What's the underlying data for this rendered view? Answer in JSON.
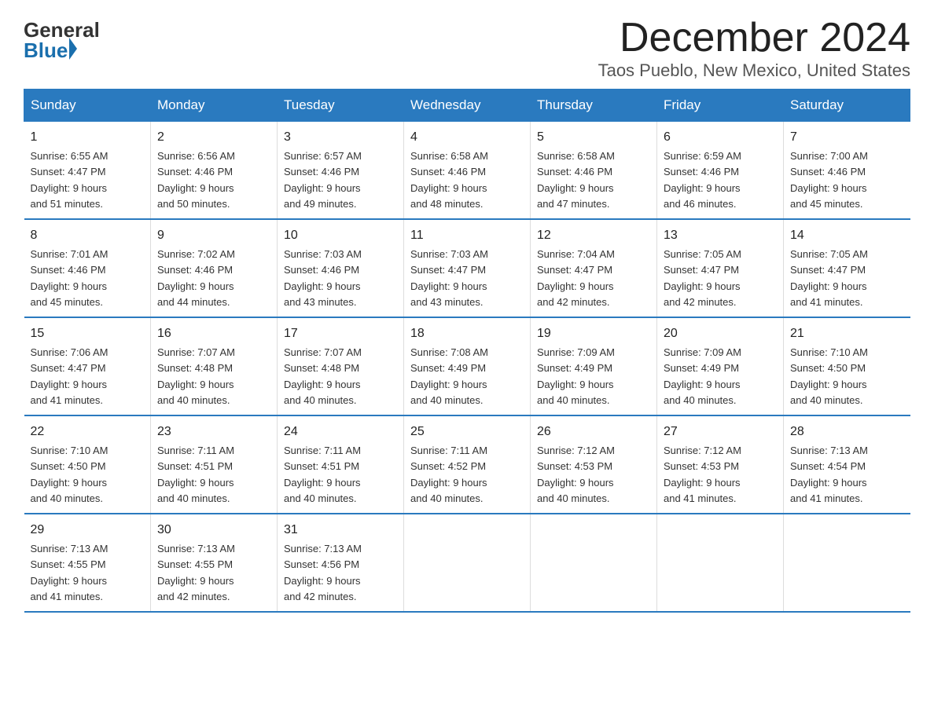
{
  "logo": {
    "general": "General",
    "blue": "Blue"
  },
  "title": {
    "month_year": "December 2024",
    "location": "Taos Pueblo, New Mexico, United States"
  },
  "header_days": [
    "Sunday",
    "Monday",
    "Tuesday",
    "Wednesday",
    "Thursday",
    "Friday",
    "Saturday"
  ],
  "weeks": [
    [
      {
        "day": "1",
        "sunrise": "6:55 AM",
        "sunset": "4:47 PM",
        "daylight": "9 hours and 51 minutes."
      },
      {
        "day": "2",
        "sunrise": "6:56 AM",
        "sunset": "4:46 PM",
        "daylight": "9 hours and 50 minutes."
      },
      {
        "day": "3",
        "sunrise": "6:57 AM",
        "sunset": "4:46 PM",
        "daylight": "9 hours and 49 minutes."
      },
      {
        "day": "4",
        "sunrise": "6:58 AM",
        "sunset": "4:46 PM",
        "daylight": "9 hours and 48 minutes."
      },
      {
        "day": "5",
        "sunrise": "6:58 AM",
        "sunset": "4:46 PM",
        "daylight": "9 hours and 47 minutes."
      },
      {
        "day": "6",
        "sunrise": "6:59 AM",
        "sunset": "4:46 PM",
        "daylight": "9 hours and 46 minutes."
      },
      {
        "day": "7",
        "sunrise": "7:00 AM",
        "sunset": "4:46 PM",
        "daylight": "9 hours and 45 minutes."
      }
    ],
    [
      {
        "day": "8",
        "sunrise": "7:01 AM",
        "sunset": "4:46 PM",
        "daylight": "9 hours and 45 minutes."
      },
      {
        "day": "9",
        "sunrise": "7:02 AM",
        "sunset": "4:46 PM",
        "daylight": "9 hours and 44 minutes."
      },
      {
        "day": "10",
        "sunrise": "7:03 AM",
        "sunset": "4:46 PM",
        "daylight": "9 hours and 43 minutes."
      },
      {
        "day": "11",
        "sunrise": "7:03 AM",
        "sunset": "4:47 PM",
        "daylight": "9 hours and 43 minutes."
      },
      {
        "day": "12",
        "sunrise": "7:04 AM",
        "sunset": "4:47 PM",
        "daylight": "9 hours and 42 minutes."
      },
      {
        "day": "13",
        "sunrise": "7:05 AM",
        "sunset": "4:47 PM",
        "daylight": "9 hours and 42 minutes."
      },
      {
        "day": "14",
        "sunrise": "7:05 AM",
        "sunset": "4:47 PM",
        "daylight": "9 hours and 41 minutes."
      }
    ],
    [
      {
        "day": "15",
        "sunrise": "7:06 AM",
        "sunset": "4:47 PM",
        "daylight": "9 hours and 41 minutes."
      },
      {
        "day": "16",
        "sunrise": "7:07 AM",
        "sunset": "4:48 PM",
        "daylight": "9 hours and 40 minutes."
      },
      {
        "day": "17",
        "sunrise": "7:07 AM",
        "sunset": "4:48 PM",
        "daylight": "9 hours and 40 minutes."
      },
      {
        "day": "18",
        "sunrise": "7:08 AM",
        "sunset": "4:49 PM",
        "daylight": "9 hours and 40 minutes."
      },
      {
        "day": "19",
        "sunrise": "7:09 AM",
        "sunset": "4:49 PM",
        "daylight": "9 hours and 40 minutes."
      },
      {
        "day": "20",
        "sunrise": "7:09 AM",
        "sunset": "4:49 PM",
        "daylight": "9 hours and 40 minutes."
      },
      {
        "day": "21",
        "sunrise": "7:10 AM",
        "sunset": "4:50 PM",
        "daylight": "9 hours and 40 minutes."
      }
    ],
    [
      {
        "day": "22",
        "sunrise": "7:10 AM",
        "sunset": "4:50 PM",
        "daylight": "9 hours and 40 minutes."
      },
      {
        "day": "23",
        "sunrise": "7:11 AM",
        "sunset": "4:51 PM",
        "daylight": "9 hours and 40 minutes."
      },
      {
        "day": "24",
        "sunrise": "7:11 AM",
        "sunset": "4:51 PM",
        "daylight": "9 hours and 40 minutes."
      },
      {
        "day": "25",
        "sunrise": "7:11 AM",
        "sunset": "4:52 PM",
        "daylight": "9 hours and 40 minutes."
      },
      {
        "day": "26",
        "sunrise": "7:12 AM",
        "sunset": "4:53 PM",
        "daylight": "9 hours and 40 minutes."
      },
      {
        "day": "27",
        "sunrise": "7:12 AM",
        "sunset": "4:53 PM",
        "daylight": "9 hours and 41 minutes."
      },
      {
        "day": "28",
        "sunrise": "7:13 AM",
        "sunset": "4:54 PM",
        "daylight": "9 hours and 41 minutes."
      }
    ],
    [
      {
        "day": "29",
        "sunrise": "7:13 AM",
        "sunset": "4:55 PM",
        "daylight": "9 hours and 41 minutes."
      },
      {
        "day": "30",
        "sunrise": "7:13 AM",
        "sunset": "4:55 PM",
        "daylight": "9 hours and 42 minutes."
      },
      {
        "day": "31",
        "sunrise": "7:13 AM",
        "sunset": "4:56 PM",
        "daylight": "9 hours and 42 minutes."
      },
      null,
      null,
      null,
      null
    ]
  ],
  "labels": {
    "sunrise_prefix": "Sunrise: ",
    "sunset_prefix": "Sunset: ",
    "daylight_prefix": "Daylight: "
  }
}
